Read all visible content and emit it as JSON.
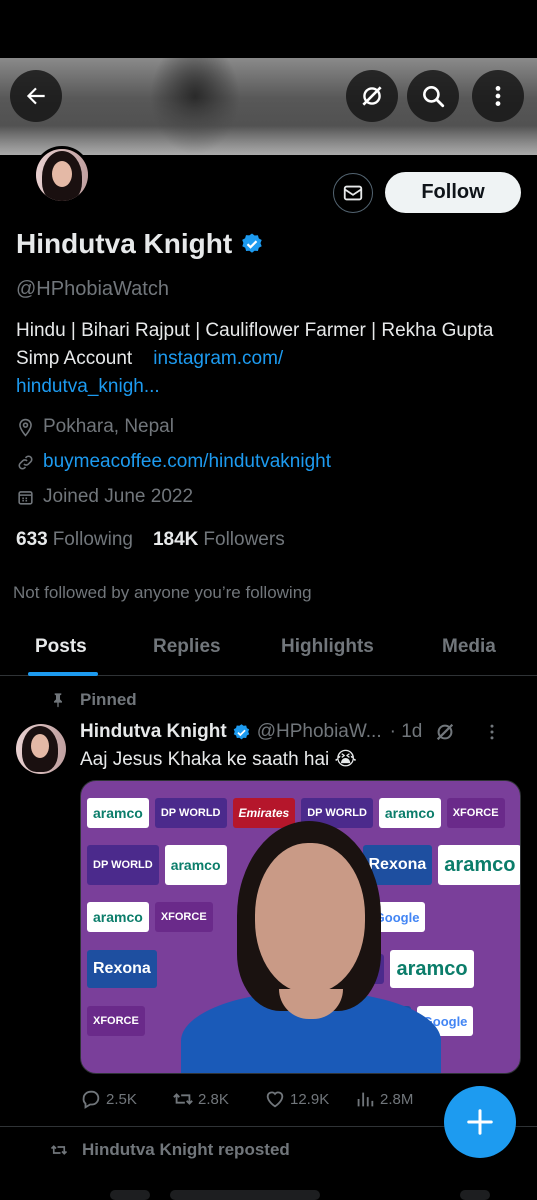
{
  "profile": {
    "display_name": "Hindutva Knight",
    "handle": "@HPhobiaWatch",
    "bio_text": "Hindu | Bihari Rajput | Cauliflower Farmer | Rekha Gupta Simp Account",
    "bio_link_1": "instagram.com/",
    "bio_link_2": "hindutva_knigh...",
    "location": "Pokhara, Nepal",
    "website": "buymeacoffee.com/hindutvaknight",
    "joined": "Joined June 2022",
    "following_count": "633",
    "following_label": "Following",
    "followers_count": "184K",
    "followers_label": "Followers",
    "not_followed": "Not followed by anyone you’re following"
  },
  "header": {
    "follow_label": "Follow"
  },
  "tabs": [
    {
      "label": "Posts",
      "active": true
    },
    {
      "label": "Replies",
      "active": false
    },
    {
      "label": "Highlights",
      "active": false
    },
    {
      "label": "Media",
      "active": false
    }
  ],
  "pinned_post": {
    "pinned_label": "Pinned",
    "author": "Hindutva Knight",
    "handle": "@HPhobiaW...",
    "time": "· 1d",
    "text": "Aaj Jesus Khaka ke saath hai 😭",
    "board_texts": [
      "aramco",
      "DP WORLD",
      "Emirates",
      "XFORCE",
      "Rexona",
      "Google"
    ],
    "stats": {
      "replies": "2.5K",
      "reposts": "2.8K",
      "likes": "12.9K",
      "views": "2.8M"
    }
  },
  "repost_notice": "Hindutva Knight reposted",
  "colors": {
    "accent": "#1d9bf0",
    "background": "#000000",
    "secondary_text": "#71767b"
  }
}
